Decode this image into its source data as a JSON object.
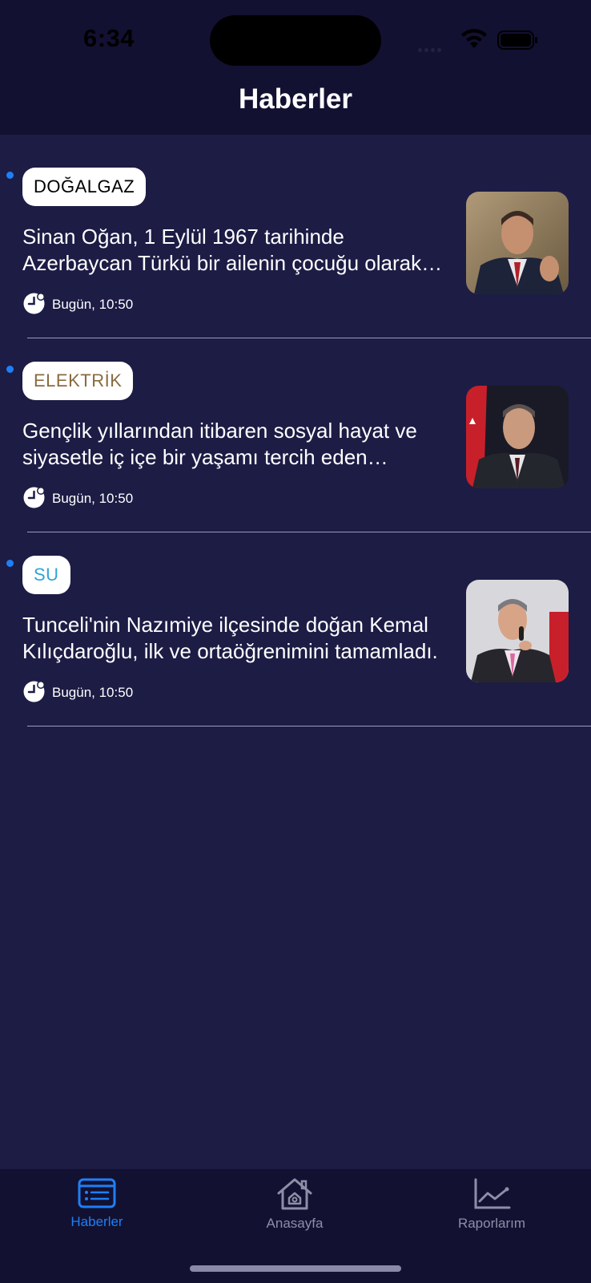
{
  "status_bar": {
    "time": "6:34"
  },
  "header": {
    "title": "Haberler"
  },
  "news": [
    {
      "tag": "DOĞALGAZ",
      "tag_color": "#000000",
      "headline": "Sinan Oğan, 1 Eylül 1967 tarihinde Azerbaycan Türkü bir ailenin çocuğu olarak dünyaya geldi.",
      "time": "Bugün, 10:50"
    },
    {
      "tag": "ELEKTRİK",
      "tag_color": "#8a6a3f",
      "headline": "Gençlik yıllarından itibaren sosyal hayat ve siyasetle iç içe bir yaşamı tercih eden Erdoğan",
      "time": "Bugün, 10:50"
    },
    {
      "tag": "SU",
      "tag_color": "#2fa4d6",
      "headline": "Tunceli'nin Nazımiye ilçesinde doğan Kemal Kılıçdaroğlu, ilk ve ortaöğrenimini tamamladı.",
      "time": "Bugün, 10:50"
    }
  ],
  "tabbar": {
    "tabs": [
      {
        "label": "Haberler",
        "icon": "news-list-icon",
        "active": true,
        "color": "#1f7ff5"
      },
      {
        "label": "Anasayfa",
        "icon": "home-icon",
        "active": false,
        "color": "#8e8ea6"
      },
      {
        "label": "Raporlarım",
        "icon": "chart-icon",
        "active": false,
        "color": "#8e8ea6"
      }
    ]
  }
}
